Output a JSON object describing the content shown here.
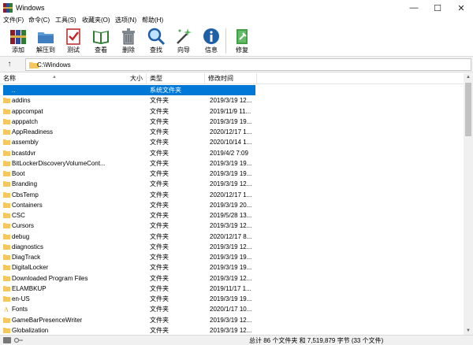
{
  "window": {
    "title": "Windows"
  },
  "menu": [
    "文件(F)",
    "命令(C)",
    "工具(S)",
    "收藏夹(O)",
    "选项(N)",
    "帮助(H)"
  ],
  "toolbar": [
    {
      "label": "添加",
      "icon": "add-archive-icon"
    },
    {
      "label": "解压到",
      "icon": "extract-to-icon"
    },
    {
      "label": "测试",
      "icon": "test-icon"
    },
    {
      "label": "查看",
      "icon": "view-icon"
    },
    {
      "label": "删除",
      "icon": "delete-icon"
    },
    {
      "label": "查找",
      "icon": "find-icon"
    },
    {
      "label": "向导",
      "icon": "wizard-icon"
    },
    {
      "label": "信息",
      "icon": "info-icon"
    },
    {
      "label": "修复",
      "icon": "repair-icon"
    }
  ],
  "address": {
    "path": "C:\\Windows"
  },
  "columns": {
    "name": "名称",
    "size": "大小",
    "type": "类型",
    "modified": "修改时间"
  },
  "rows": [
    {
      "name": "..",
      "type": "系统文件夹",
      "date": "",
      "selected": true
    },
    {
      "name": "addins",
      "type": "文件夹",
      "date": "2019/3/19 12..."
    },
    {
      "name": "appcompat",
      "type": "文件夹",
      "date": "2019/11/9 11..."
    },
    {
      "name": "apppatch",
      "type": "文件夹",
      "date": "2019/3/19 19..."
    },
    {
      "name": "AppReadiness",
      "type": "文件夹",
      "date": "2020/12/17 1..."
    },
    {
      "name": "assembly",
      "type": "文件夹",
      "date": "2020/10/14 1..."
    },
    {
      "name": "bcastdvr",
      "type": "文件夹",
      "date": "2019/4/2 7:09"
    },
    {
      "name": "BitLockerDiscoveryVolumeCont...",
      "type": "文件夹",
      "date": "2019/3/19 19..."
    },
    {
      "name": "Boot",
      "type": "文件夹",
      "date": "2019/3/19 19..."
    },
    {
      "name": "Branding",
      "type": "文件夹",
      "date": "2019/3/19 12..."
    },
    {
      "name": "CbsTemp",
      "type": "文件夹",
      "date": "2020/12/17 1..."
    },
    {
      "name": "Containers",
      "type": "文件夹",
      "date": "2019/3/19 20..."
    },
    {
      "name": "CSC",
      "type": "文件夹",
      "date": "2019/5/28 13..."
    },
    {
      "name": "Cursors",
      "type": "文件夹",
      "date": "2019/3/19 12..."
    },
    {
      "name": "debug",
      "type": "文件夹",
      "date": "2020/12/17 8..."
    },
    {
      "name": "diagnostics",
      "type": "文件夹",
      "date": "2019/3/19 12..."
    },
    {
      "name": "DiagTrack",
      "type": "文件夹",
      "date": "2019/3/19 19..."
    },
    {
      "name": "DigitalLocker",
      "type": "文件夹",
      "date": "2019/3/19 19..."
    },
    {
      "name": "Downloaded Program Files",
      "type": "文件夹",
      "date": "2019/3/19 12..."
    },
    {
      "name": "ELAMBKUP",
      "type": "文件夹",
      "date": "2019/11/17 1..."
    },
    {
      "name": "en-US",
      "type": "文件夹",
      "date": "2019/3/19 19..."
    },
    {
      "name": "Fonts",
      "type": "文件夹",
      "date": "2020/1/17 10...",
      "icon": "fonts"
    },
    {
      "name": "GameBarPresenceWriter",
      "type": "文件夹",
      "date": "2019/3/19 12..."
    },
    {
      "name": "Globalization",
      "type": "文件夹",
      "date": "2019/3/19 12..."
    }
  ],
  "status": {
    "summary": "总计 86 个文件夹 和 7,519,879 字节 (33 个文件)"
  },
  "colors": {
    "selection": "#0078d7",
    "folder": "#f6c75d"
  }
}
